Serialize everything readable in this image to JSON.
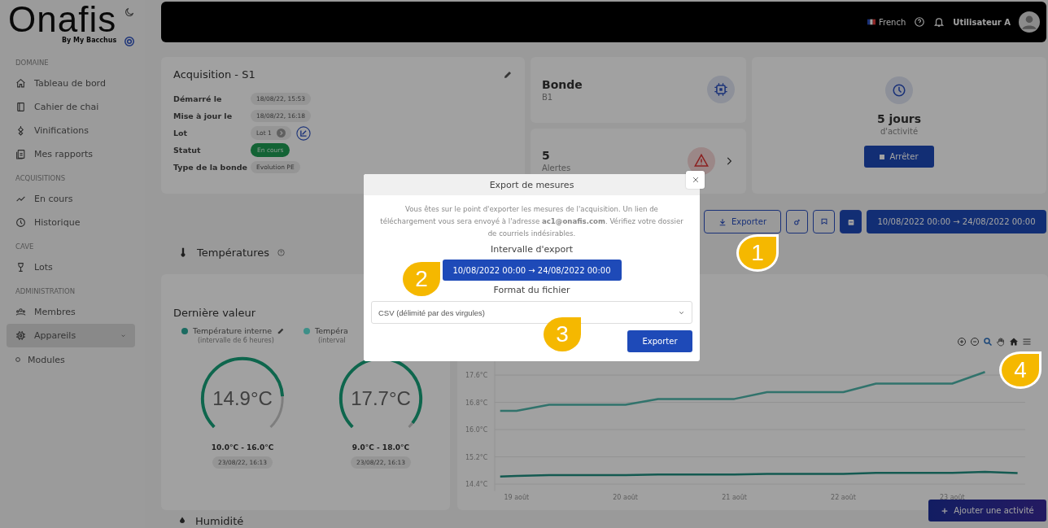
{
  "sidebar": {
    "logo": "Onafis",
    "logo_subtitle": "By My Bacchus",
    "sections": [
      {
        "title": "DOMAINE",
        "items": [
          {
            "label": "Tableau de bord",
            "selected": false
          },
          {
            "label": "Cahier de chai",
            "selected": false
          },
          {
            "label": "Vinifications",
            "selected": false
          },
          {
            "label": "Mes rapports",
            "selected": false
          }
        ]
      },
      {
        "title": "ACQUISITIONS",
        "items": [
          {
            "label": "En cours",
            "selected": false
          },
          {
            "label": "Historique",
            "selected": false
          }
        ]
      },
      {
        "title": "CAVE",
        "items": [
          {
            "label": "Lots",
            "selected": false
          }
        ]
      },
      {
        "title": "ADMINISTRATION",
        "items": [
          {
            "label": "Membres",
            "selected": false
          },
          {
            "label": "Appareils",
            "selected": true,
            "children": [
              {
                "label": "Modules"
              }
            ]
          }
        ]
      }
    ]
  },
  "header": {
    "language": "French",
    "user": "Utilisateur A"
  },
  "acquisition": {
    "title": "Acquisition - S1",
    "fields": [
      {
        "label": "Démarré le",
        "value": "18/08/22, 15:53",
        "kind": "chip"
      },
      {
        "label": "Mise à jour le",
        "value": "18/08/22, 16:18",
        "kind": "chip"
      },
      {
        "label": "Lot",
        "value": "Lot 1",
        "kind": "lot"
      },
      {
        "label": "Statut",
        "value": "En cours",
        "kind": "status"
      },
      {
        "label": "Type de la bonde",
        "value": "Evolution PE",
        "kind": "chip"
      }
    ]
  },
  "bonde": {
    "title": "Bonde",
    "subtitle": "B1"
  },
  "alerts": {
    "count": "5",
    "label": "Alertes"
  },
  "activity": {
    "value": "5 jours",
    "label": "d'activité",
    "stop_button": "Arrêter"
  },
  "actions": {
    "export_button": "Exporter",
    "date_range": "10/08/2022 00:00 → 24/08/2022 00:00"
  },
  "temperatures": {
    "title": "Températures",
    "last_value_title": "Dernière valeur",
    "gauges": [
      {
        "name": "Température interne",
        "interval": "(intervalle de 6 heures)",
        "value": "14.9°C",
        "range": "10.0°C - 16.0°C",
        "timestamp": "23/08/22, 16:13",
        "level": 0.82,
        "color": "#1b6b61",
        "editable": true
      },
      {
        "name": "Tempéra",
        "interval": "(interval",
        "value": "17.7°C",
        "range": "9.0°C - 18.0°C",
        "timestamp": "23/08/22, 16:13",
        "level": 0.97,
        "color": "#3d8f88",
        "editable": false
      }
    ],
    "chart": {
      "chart_data": {
        "type": "line",
        "grid": true,
        "x": [
          18.85,
          19.0,
          19.3,
          20.0,
          20.3,
          21.0,
          21.3,
          22.0,
          22.3,
          23.0,
          23.3,
          23.6
        ],
        "series": [
          {
            "color": "#31736c",
            "values": [
              16.55,
              16.55,
              16.73,
              16.73,
              16.9,
              16.9,
              17.1,
              17.1,
              17.35,
              17.35,
              17.69,
              null
            ]
          },
          {
            "color": "#145a51",
            "values": [
              14.62,
              14.64,
              14.66,
              14.66,
              14.68,
              14.68,
              14.7,
              14.7,
              14.73,
              14.73,
              14.76,
              14.72
            ]
          }
        ],
        "xlim": [
          18.8,
          23.67
        ],
        "ylim": [
          14.2,
          18.0
        ],
        "xticks": [
          {
            "value": 19,
            "label": "19 août"
          },
          {
            "value": 20,
            "label": "20 août"
          },
          {
            "value": 21,
            "label": "21 août"
          },
          {
            "value": 22,
            "label": "22 août"
          },
          {
            "value": 23,
            "label": "23 août"
          }
        ],
        "yticks": [
          {
            "value": 14.4,
            "label": "14.4°C"
          },
          {
            "value": 15.2,
            "label": "15.2°C"
          },
          {
            "value": 16.0,
            "label": "16.0°C"
          },
          {
            "value": 16.8,
            "label": "16.8°C"
          },
          {
            "value": 17.6,
            "label": "17.6°C"
          }
        ]
      }
    }
  },
  "humidity_title": "Humidité",
  "add_activity_button": "Ajouter une activité",
  "modal": {
    "title": "Export de mesures",
    "message": "Vous êtes sur le point d'exporter les mesures de l'acquisition. Un lien de téléchargement vous sera envoyé à l'adresse **ac1@onafis.com**. Vérifiez votre dossier de courriels indésirables.",
    "interval_label": "Intervalle d'export",
    "interval_value": "10/08/2022 00:00 → 24/08/2022 00:00",
    "format_label": "Format du fichier",
    "format_value": "CSV (délimité par des virgules)",
    "submit": "Exporter"
  },
  "callouts": [
    {
      "label": "1",
      "outlined": true
    },
    {
      "label": "2",
      "outlined": false
    },
    {
      "label": "3",
      "outlined": false
    },
    {
      "label": "4",
      "outlined": true
    }
  ]
}
